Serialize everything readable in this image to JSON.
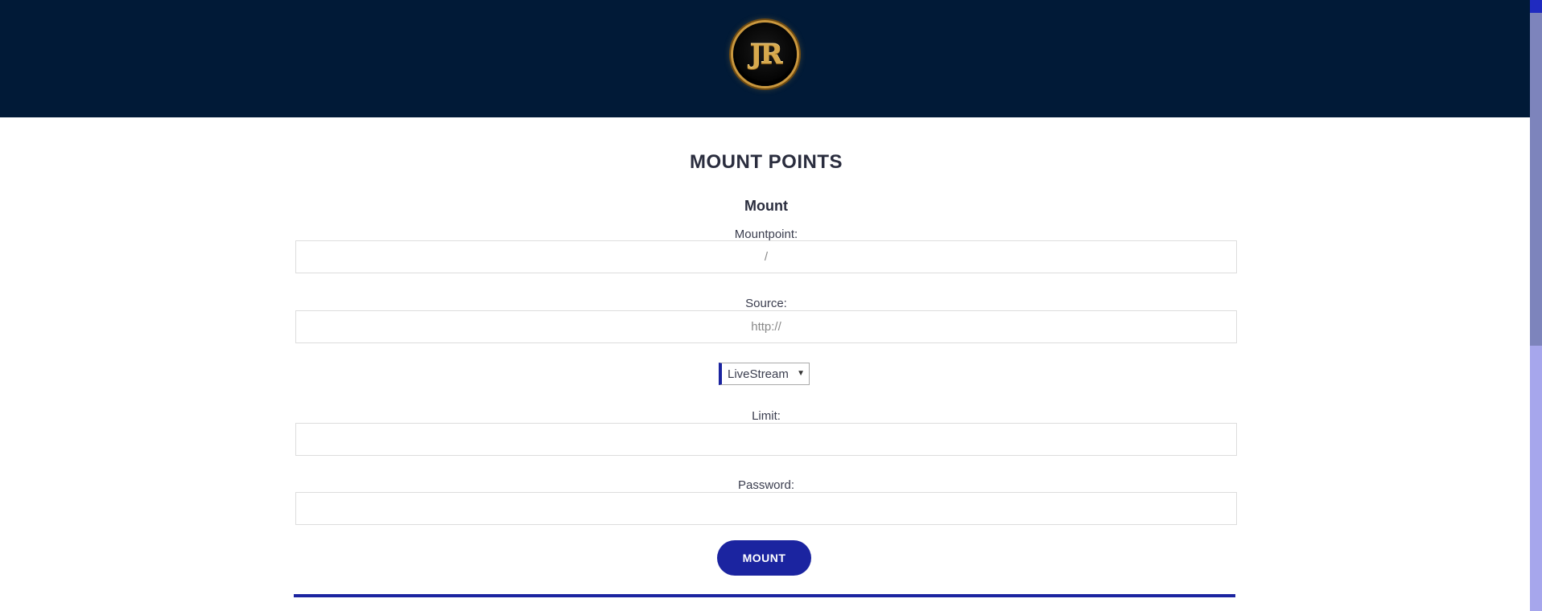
{
  "header": {
    "logo_text": "JR",
    "background_color": "#011a37"
  },
  "main": {
    "title": "MOUNT POINTS",
    "section_title": "Mount",
    "fields": {
      "mountpoint": {
        "label": "Mountpoint:",
        "value": "",
        "placeholder": "/"
      },
      "source": {
        "label": "Source:",
        "value": "",
        "placeholder": "http://"
      },
      "type_select": {
        "selected": "LiveStream"
      },
      "limit": {
        "label": "Limit:",
        "value": "",
        "placeholder": ""
      },
      "password": {
        "label": "Password:",
        "value": "",
        "placeholder": ""
      }
    },
    "submit_label": "MOUNT",
    "accent_color": "#1b24a0"
  }
}
